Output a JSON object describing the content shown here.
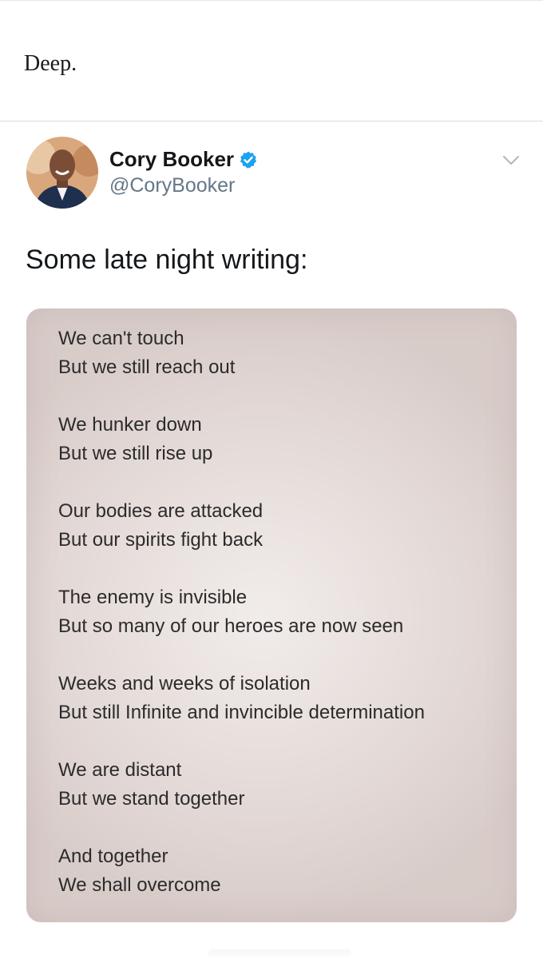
{
  "caption": "Deep.",
  "tweet": {
    "author_name": "Cory Booker",
    "handle": "@CoryBooker",
    "text": "Some late night writing:",
    "verified_color": "#1da1f2"
  },
  "poem": {
    "stanzas": [
      [
        "We can't touch",
        "But we still reach out"
      ],
      [
        "We hunker down",
        "But we still rise up"
      ],
      [
        "Our bodies are attacked",
        "But our spirits fight back"
      ],
      [
        "The enemy is invisible",
        "But so many of our heroes are now seen"
      ],
      [
        "Weeks and weeks of isolation",
        "But still Infinite and invincible determination"
      ],
      [
        "We are distant",
        "But we stand together"
      ],
      [
        "And together",
        "We shall overcome"
      ]
    ]
  },
  "icons": {
    "verified": "verified-badge-icon",
    "menu": "chevron-down-icon",
    "avatar": "profile-photo"
  }
}
